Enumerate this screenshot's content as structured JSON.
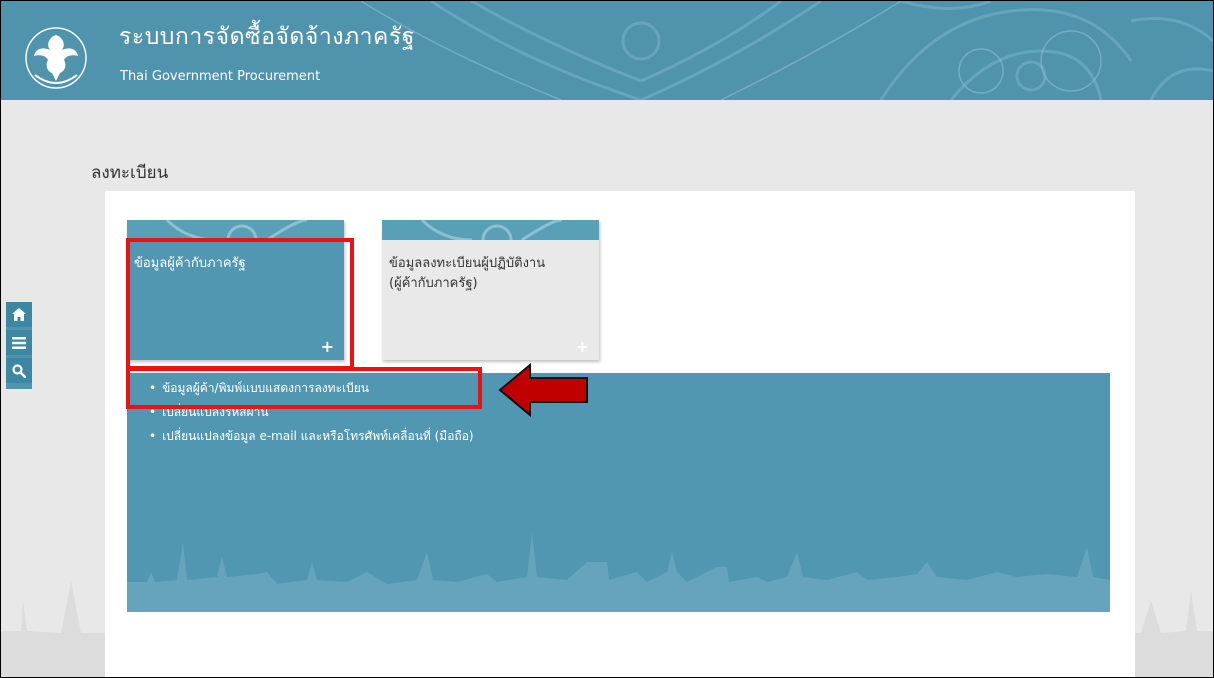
{
  "header": {
    "title": "ระบบการจัดซื้อจัดจ้างภาครัฐ",
    "subtitle": "Thai Government Procurement",
    "logo_icon": "garuda-logo-icon"
  },
  "page": {
    "title": "ลงทะเบียน"
  },
  "tiles": [
    {
      "label": "ข้อมูลผู้ค้ากับภาครัฐ",
      "state": "active"
    },
    {
      "label_line1": "ข้อมูลลงทะเบียนผู้ปฏิบัติงาน",
      "label_line2": "(ผู้ค้ากับภาครัฐ)",
      "state": "inactive"
    }
  ],
  "submenu": {
    "items": [
      {
        "label": "ข้อมูลผู้ค้า/พิมพ์แบบแสดงการลงทะเบียน"
      },
      {
        "label": "เปลี่ยนแปลงรหัสผ่าน"
      },
      {
        "label": "เปลี่ยนแปลงข้อมูล e-mail และหรือโทรศัพท์เคลื่อนที่ (มือถือ)"
      }
    ]
  },
  "sidebar": {
    "icons": [
      "home-icon",
      "menu-icon",
      "search-icon"
    ]
  },
  "colors": {
    "header_bg": "#4f93ad",
    "tile_active": "#5197b1",
    "highlight": "#ee1111",
    "arrow": "#c00000"
  }
}
